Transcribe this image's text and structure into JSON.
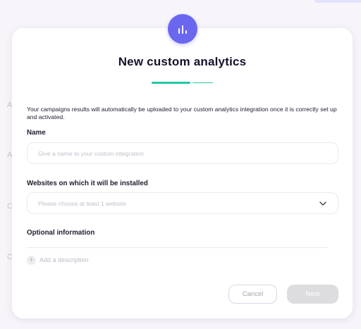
{
  "background": {
    "letters": [
      "A",
      "A",
      "C",
      "C"
    ]
  },
  "modal": {
    "icon": "bar-chart-icon",
    "title": "New custom analytics",
    "intro": "Your campaigns results will automatically be uploaded to your custom analytics integration once it is correctly set up and activated.",
    "name": {
      "label": "Name",
      "value": "",
      "placeholder": "Give a name to your custom integration"
    },
    "websites": {
      "label": "Websites on which it will be installed",
      "placeholder": "Please choose at least 1 website"
    },
    "optional": {
      "label": "Optional information",
      "add_description": "Add a description"
    },
    "buttons": {
      "cancel": "Cancel",
      "next": "Next"
    }
  },
  "colors": {
    "accent": "#6a66f0",
    "progress": "#23c7a5",
    "disabled_button": "#dddcde"
  },
  "progress": {
    "current_step": 1,
    "total_steps": 2
  }
}
